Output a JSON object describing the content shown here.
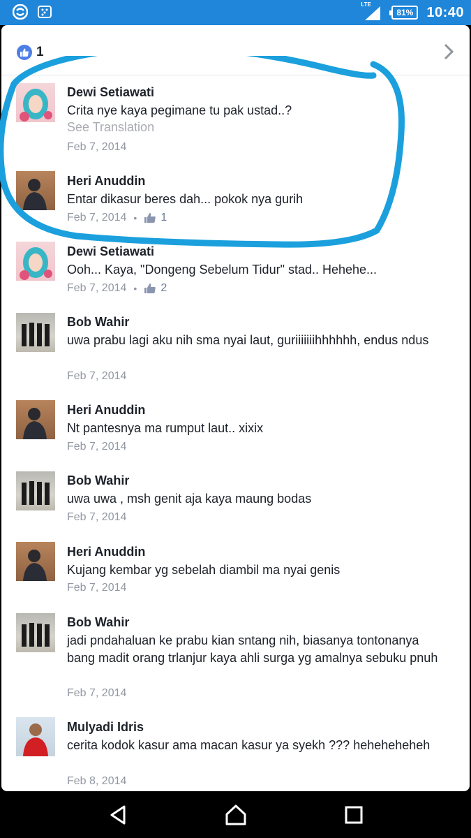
{
  "status_bar": {
    "time": "10:40",
    "battery": "81%",
    "network": "LTE",
    "icons": [
      "sync-icon",
      "bbm-icon",
      "signal-icon",
      "battery-icon"
    ]
  },
  "reactions": {
    "count": "1",
    "icon": "like-icon"
  },
  "comments": [
    {
      "author": "Dewi Setiawati",
      "text": "Crita nye kaya pegimane tu pak ustad..?",
      "translation": "See Translation",
      "date": "Feb 7, 2014",
      "likes": ""
    },
    {
      "author": "Heri Anuddin",
      "text": "Entar dikasur beres dah... pokok nya gurih",
      "date": "Feb 7, 2014",
      "likes": "1"
    },
    {
      "author": "Dewi Setiawati",
      "text": "Ooh... Kaya, \"Dongeng Sebelum Tidur\" stad.. Hehehe...",
      "date": "Feb 7, 2014",
      "likes": "2"
    },
    {
      "author": "Bob Wahir",
      "text": "uwa prabu lagi aku nih sma nyai laut, guriiiiiiihhhhhh, endus ndus",
      "date": "Feb 7, 2014",
      "likes": ""
    },
    {
      "author": "Heri Anuddin",
      "text": "Nt pantesnya ma rumput laut.. xixix",
      "date": "Feb 7, 2014",
      "likes": ""
    },
    {
      "author": "Bob Wahir",
      "text": "uwa uwa , msh genit aja kaya maung bodas",
      "date": "Feb 7, 2014",
      "likes": ""
    },
    {
      "author": "Heri Anuddin",
      "text": "Kujang kembar yg sebelah diambil ma nyai genis",
      "date": "Feb 7, 2014",
      "likes": ""
    },
    {
      "author": "Bob Wahir",
      "text": "jadi pndahaluan ke prabu kian sntang nih, biasanya tontonanya bang madit orang trlanjur kaya ahli surga yg amalnya sebuku pnuh",
      "date": "Feb 7, 2014",
      "likes": ""
    },
    {
      "author": "Mulyadi Idris",
      "text": "cerita kodok kasur ama macan kasur ya syekh ??? heheheheheh",
      "date": "Feb 8, 2014",
      "likes": ""
    }
  ],
  "colors": {
    "status_bar": "#1f86d9",
    "annotation": "#1ba0dd",
    "like_badge": "#4d7fe7",
    "meta_text": "#9197a3"
  },
  "nav": {
    "back": "back-icon",
    "home": "home-icon",
    "recents": "recents-icon"
  }
}
